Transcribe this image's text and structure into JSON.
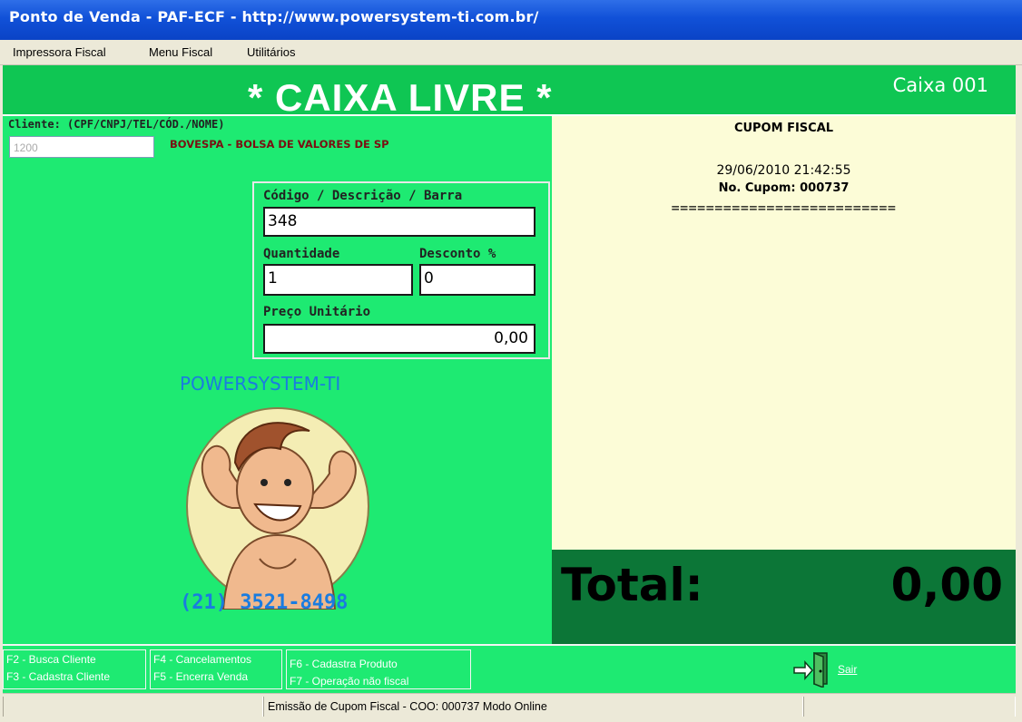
{
  "window": {
    "title": "Ponto de Venda - PAF-ECF - http://www.powersystem-ti.com.br/"
  },
  "menu": {
    "items": [
      "Impressora Fiscal",
      "Menu Fiscal",
      "Utilitários"
    ]
  },
  "banner": {
    "status": "* CAIXA LIVRE *",
    "register": "Caixa 001"
  },
  "client": {
    "label": "Cliente: (CPF/CNPJ/TEL/CÓD./NOME)",
    "code": "1200",
    "name": "BOVESPA - BOLSA DE VALORES DE SP"
  },
  "product": {
    "code_label": "Código / Descrição / Barra",
    "code_value": "348",
    "qty_label": "Quantidade",
    "qty_value": "1",
    "discount_label": "Desconto %",
    "discount_value": "0",
    "price_label": "Preço Unitário",
    "price_value": "0,00"
  },
  "promo": {
    "brand": "POWERSYSTEM-TI",
    "phone": "(21) 3521-8498"
  },
  "receipt": {
    "title": "CUPOM FISCAL",
    "datetime": "29/06/2010 21:42:55",
    "cupom": "No. Cupom: 000737",
    "separator": "=========================="
  },
  "total": {
    "label": "Total:",
    "value": "0,00"
  },
  "function_keys": {
    "f2": "F2 - Busca Cliente",
    "f3": "F3 - Cadastra Cliente",
    "f4": "F4 - Cancelamentos",
    "f5": "F5 - Encerra Venda",
    "f6": "F6 - Cadastra Produto",
    "f7": "F7 - Operação não fiscal",
    "exit": "Sair"
  },
  "status": {
    "text": "Emissão de Cupom Fiscal - COO: 000737  Modo Online"
  },
  "colors": {
    "panel_green": "#1eea72",
    "banner_green": "#0fc653",
    "total_green": "#0c7637",
    "receipt_bg": "#fcfcd7",
    "brand_blue": "#1a7ce0"
  },
  "icons": {
    "exit": "door-exit-icon",
    "mascot": "strongman-mascot-icon"
  }
}
